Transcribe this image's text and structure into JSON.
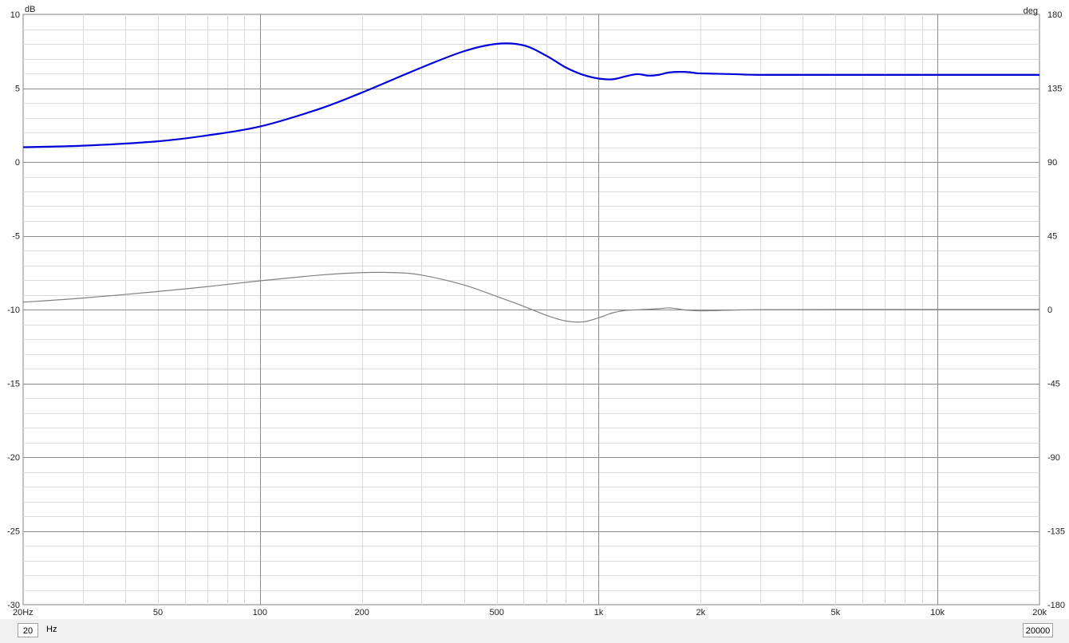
{
  "chart_data": {
    "type": "line",
    "x_scale": "log",
    "xlim": [
      20,
      20000
    ],
    "y_left": {
      "unit_label": "dB",
      "ylim": [
        -30,
        10
      ],
      "ticks": [
        "10",
        "5",
        "0",
        "-5",
        "-10",
        "-15",
        "-20",
        "-25",
        "-30"
      ]
    },
    "y_right": {
      "unit_label": "deg",
      "ylim": [
        -180,
        180
      ],
      "ticks": [
        "180",
        "135",
        "90",
        "45",
        "0",
        "-45",
        "-90",
        "-135",
        "-180"
      ]
    },
    "x_ticks": [
      {
        "value": 20,
        "label": "20Hz"
      },
      {
        "value": 50,
        "label": "50"
      },
      {
        "value": 100,
        "label": "100"
      },
      {
        "value": 200,
        "label": "200"
      },
      {
        "value": 500,
        "label": "500"
      },
      {
        "value": 1000,
        "label": "1k"
      },
      {
        "value": 2000,
        "label": "2k"
      },
      {
        "value": 5000,
        "label": "5k"
      },
      {
        "value": 10000,
        "label": "10k"
      },
      {
        "value": 20000,
        "label": "20k"
      }
    ],
    "grid": true,
    "series": [
      {
        "axis": "left",
        "color": "#0000dd",
        "x": [
          20,
          30,
          50,
          70,
          100,
          150,
          200,
          300,
          400,
          500,
          600,
          700,
          800,
          900,
          1000,
          1100,
          1200,
          1300,
          1400,
          1500,
          1600,
          1700,
          1800,
          1900,
          2000,
          2500,
          3000,
          5000,
          10000,
          20000
        ],
        "values": [
          1.0,
          1.1,
          1.4,
          1.8,
          2.4,
          3.6,
          4.7,
          6.4,
          7.5,
          8.0,
          7.9,
          7.2,
          6.4,
          5.9,
          5.65,
          5.6,
          5.8,
          5.95,
          5.85,
          5.9,
          6.05,
          6.1,
          6.1,
          6.05,
          6.0,
          5.95,
          5.9,
          5.9,
          5.9,
          5.9
        ]
      },
      {
        "axis": "right",
        "color": "#808080",
        "x": [
          20,
          30,
          50,
          70,
          100,
          150,
          200,
          250,
          300,
          400,
          500,
          600,
          700,
          800,
          900,
          1000,
          1100,
          1200,
          1300,
          1500,
          1600,
          1700,
          1800,
          2000,
          2500,
          3000,
          5000,
          10000,
          20000
        ],
        "values": [
          4.5,
          7.0,
          11.0,
          14.0,
          17.5,
          21.0,
          22.5,
          22.5,
          21.0,
          15.0,
          8.0,
          2.0,
          -3.5,
          -7.0,
          -7.5,
          -5.0,
          -2.0,
          -0.5,
          -0.2,
          0.5,
          1.0,
          0.5,
          -0.3,
          -0.8,
          -0.3,
          -0.1,
          0.0,
          0.0,
          0.0
        ]
      }
    ]
  },
  "controls": {
    "start_value": "20",
    "end_value": "20000",
    "unit": "Hz"
  }
}
